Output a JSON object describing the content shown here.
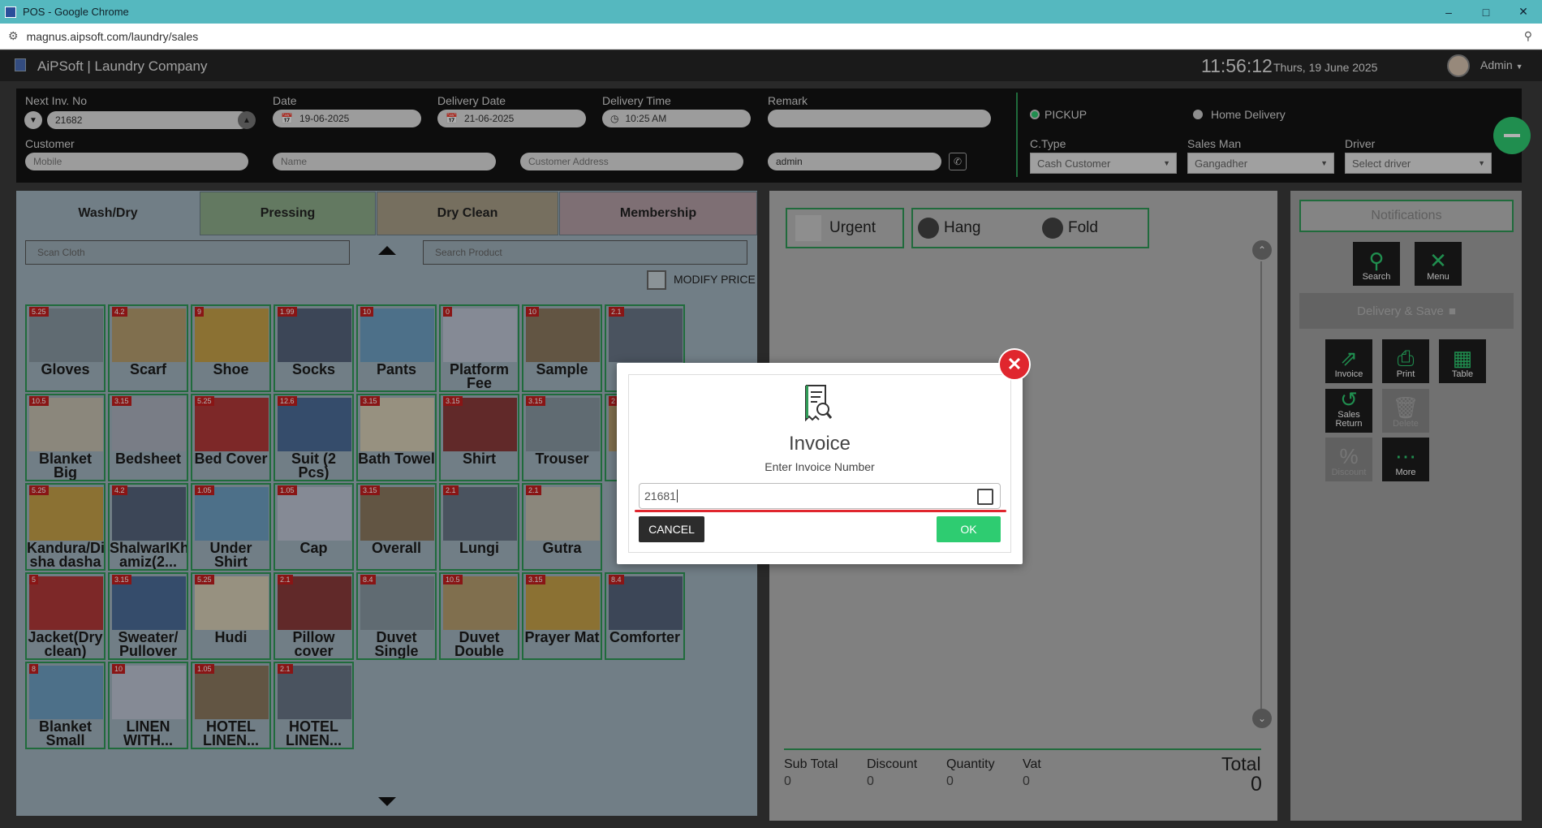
{
  "browser": {
    "window_title": "POS - Google Chrome",
    "url": "magnus.aipsoft.com/laundry/sales"
  },
  "app": {
    "title": "AiPSoft | Laundry Company",
    "time": "11:56:12",
    "date": "Thurs, 19 June 2025",
    "user": "Admin"
  },
  "form": {
    "next_inv_label": "Next Inv. No",
    "next_inv_value": "21682",
    "date_label": "Date",
    "date_value": "19-06-2025",
    "delivery_date_label": "Delivery Date",
    "delivery_date_value": "21-06-2025",
    "delivery_time_label": "Delivery Time",
    "delivery_time_value": "10:25 AM",
    "remark_label": "Remark",
    "customer_label": "Customer",
    "mobile_placeholder": "Mobile",
    "name_placeholder": "Name",
    "address_placeholder": "Customer Address",
    "staff_value": "admin",
    "pickup_label": "PICKUP",
    "home_delivery_label": "Home Delivery",
    "ctype_label": "C.Type",
    "ctype_value": "Cash Customer",
    "salesman_label": "Sales Man",
    "salesman_value": "Gangadher",
    "driver_label": "Driver",
    "driver_value": "Select driver"
  },
  "tabs": [
    {
      "label": "Wash/Dry",
      "color": "#a2b5c0"
    },
    {
      "label": "Pressing",
      "color": "#8fae8b"
    },
    {
      "label": "Dry Clean",
      "color": "#a99f89"
    },
    {
      "label": "Membership",
      "color": "#b59fa6"
    }
  ],
  "search": {
    "scan_placeholder": "Scan Cloth",
    "product_placeholder": "Search Product",
    "modify_price_label": "MODIFY PRICE"
  },
  "products": [
    {
      "name": "Gloves",
      "price": "5.25"
    },
    {
      "name": "Scarf",
      "price": "4.2"
    },
    {
      "name": "Shoe",
      "price": "9"
    },
    {
      "name": "Socks",
      "price": "1.99"
    },
    {
      "name": "Pants",
      "price": "10"
    },
    {
      "name": "Platform Fee",
      "price": "0"
    },
    {
      "name": "Sample",
      "price": "10"
    },
    {
      "name": "",
      "price": "2.1"
    },
    {
      "name": "Blanket Big",
      "price": "10.5"
    },
    {
      "name": "Bedsheet",
      "price": "3.15"
    },
    {
      "name": "Bed Cover",
      "price": "5.25"
    },
    {
      "name": "Suit (2 Pcs)",
      "price": "12.6"
    },
    {
      "name": "Bath Towel",
      "price": "3.15"
    },
    {
      "name": "Shirt",
      "price": "3.15"
    },
    {
      "name": "Trouser",
      "price": "3.15"
    },
    {
      "name": "",
      "price": "2"
    },
    {
      "name": "Kandura/Di sha dasha",
      "price": "5.25"
    },
    {
      "name": "ShalwarIKh amiz(2...",
      "price": "4.2"
    },
    {
      "name": "Under Shirt",
      "price": "1.05"
    },
    {
      "name": "Cap",
      "price": "1.05"
    },
    {
      "name": "Overall",
      "price": "3.15"
    },
    {
      "name": "Lungi",
      "price": "2.1"
    },
    {
      "name": "Gutra",
      "price": "2.1"
    },
    {
      "name": "",
      "price": ""
    },
    {
      "name": "Jacket(Dry clean)",
      "price": "5"
    },
    {
      "name": "Sweater/ Pullover",
      "price": "3.15"
    },
    {
      "name": "Hudi",
      "price": "5.25"
    },
    {
      "name": "Pillow cover",
      "price": "2.1"
    },
    {
      "name": "Duvet Single",
      "price": "8.4"
    },
    {
      "name": "Duvet Double",
      "price": "10.5"
    },
    {
      "name": "Prayer Mat",
      "price": "3.15"
    },
    {
      "name": "Comforter",
      "price": "8.4"
    },
    {
      "name": "Blanket Small",
      "price": "8"
    },
    {
      "name": "LINEN WITH...",
      "price": "10"
    },
    {
      "name": "HOTEL LINEN...",
      "price": "1.05"
    },
    {
      "name": "HOTEL LINEN...",
      "price": "2.1"
    }
  ],
  "options": {
    "urgent": "Urgent",
    "hang": "Hang",
    "fold": "Fold"
  },
  "totals": {
    "subtotal_label": "Sub Total",
    "subtotal": "0",
    "discount_label": "Discount",
    "discount": "0",
    "quantity_label": "Quantity",
    "quantity": "0",
    "vat_label": "Vat",
    "vat": "0",
    "total_label": "Total",
    "total": "0"
  },
  "right": {
    "notifications": "Notifications",
    "search": "Search",
    "menu": "Menu",
    "delivery_save": "Delivery & Save",
    "invoice": "Invoice",
    "print": "Print",
    "table": "Table",
    "sales_return": "Sales Return",
    "delete": "Delete",
    "discount": "Discount",
    "more": "More"
  },
  "modal": {
    "title": "Invoice",
    "subtitle": "Enter Invoice Number",
    "input_value": "21681",
    "cancel": "CANCEL",
    "ok": "OK"
  },
  "colors": {
    "accent_green": "#2ecc71",
    "price_red": "#c41f1f",
    "close_red": "#e0262e"
  }
}
